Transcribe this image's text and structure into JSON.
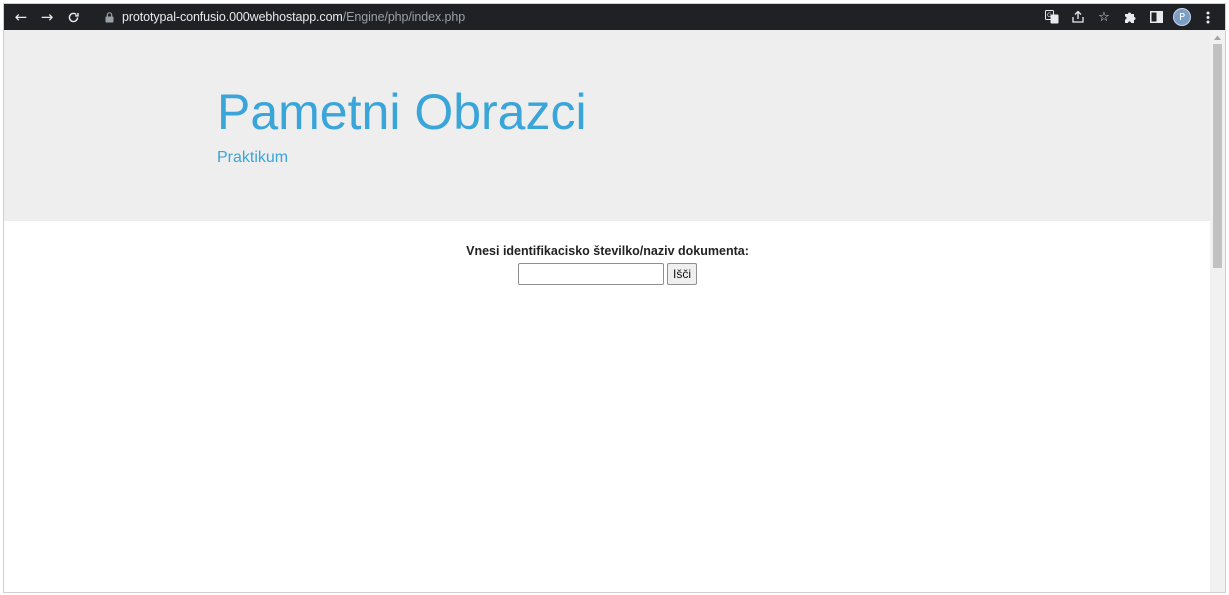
{
  "browser": {
    "url_host": "prototypal-confusio.000webhostapp.com",
    "url_path": "/Engine/php/index.php",
    "profile_initial": "P",
    "icons": {
      "back": "back-arrow-icon",
      "forward": "forward-arrow-icon",
      "reload": "reload-icon",
      "lock": "lock-icon",
      "translate": "translate-icon",
      "share": "share-icon",
      "bookmark": "star-icon",
      "extensions": "puzzle-icon",
      "side_panel": "side-panel-icon",
      "menu": "kebab-menu-icon"
    }
  },
  "header": {
    "title": "Pametni Obrazci",
    "subtitle": "Praktikum",
    "background": "#eeeeee",
    "accent": "#3aa5d8"
  },
  "search": {
    "label": "Vnesi identifikacisko številko/naziv dokumenta:",
    "input_value": "",
    "button_label": "Išči"
  }
}
